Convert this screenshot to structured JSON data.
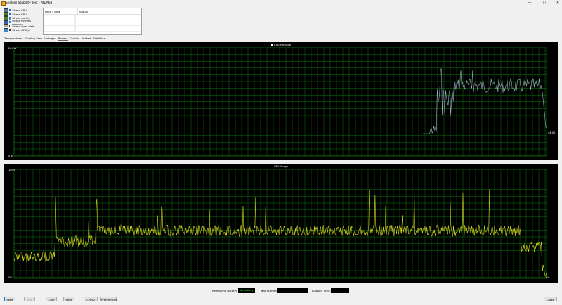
{
  "window": {
    "title": "System Stability Test - AIDA64",
    "minimize": "—",
    "maximize": "□",
    "close": "✕"
  },
  "stress": [
    {
      "label": "Stress CPU",
      "checked": true,
      "icon": "cpu-icon"
    },
    {
      "label": "Stress FPU",
      "checked": true,
      "icon": "fpu-icon"
    },
    {
      "label": "Stress cache",
      "checked": true,
      "icon": "cache-icon"
    },
    {
      "label": "Stress system memory",
      "checked": true,
      "icon": "memory-icon"
    },
    {
      "label": "Stress local disks",
      "checked": false,
      "icon": "disk-icon"
    },
    {
      "label": "Stress GPU(s)",
      "checked": false,
      "icon": "monitor-icon"
    }
  ],
  "status_table": {
    "col_date": "Date / Time",
    "col_status": "Status"
  },
  "tabs": [
    "Temperatures",
    "Cooling Fans",
    "Voltages",
    "Powers",
    "Clocks",
    "Unified",
    "Statistics"
  ],
  "active_tab": "Powers",
  "power_graph": {
    "title": "CPU Package",
    "y_max": "200 W",
    "y_min": "0 W",
    "current": "44.00",
    "color": "#9fb6c8"
  },
  "cpu_graph": {
    "title": "CPU Usage",
    "y_max": "100%",
    "y_min": "0%",
    "current": "6%",
    "color": "#d8d820"
  },
  "grid_color": "#0d7a0d",
  "status_bar": {
    "battery_label": "Remaining Battery:",
    "battery_value": "No battery",
    "started_label": "Test Started:",
    "started_value": "",
    "elapsed_label": "Elapsed Time:",
    "elapsed_value": ""
  },
  "buttons": {
    "start": "Start",
    "stop": "Stop",
    "clear": "Clear",
    "save": "Save",
    "cpuid": "CPUID",
    "preferences": "Preferences",
    "close": "Close"
  }
}
